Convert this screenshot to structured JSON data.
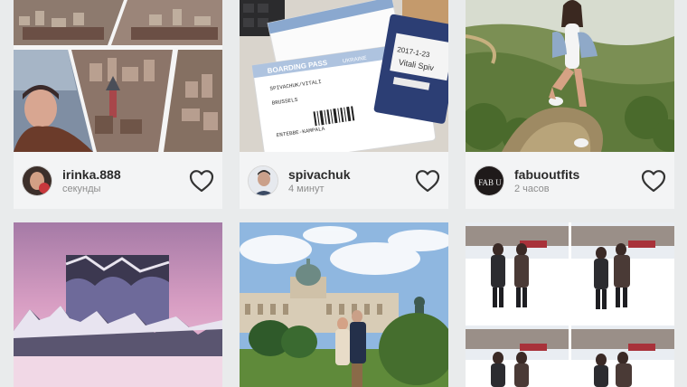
{
  "posts": [
    {
      "username": "irinka.888",
      "time": "секунды",
      "avatar": "avatar-irinka",
      "like_icon": "heart-outline-icon"
    },
    {
      "username": "spivachuk",
      "time": "4 минут",
      "avatar": "avatar-spivachuk",
      "like_icon": "heart-outline-icon"
    },
    {
      "username": "fabuoutfits",
      "time": "2 часов",
      "avatar": "avatar-fabuoutfits",
      "avatar_text": "FAB U",
      "like_icon": "heart-outline-icon"
    }
  ],
  "photos": {
    "boarding_pass": {
      "header": "BOARDING PASS",
      "country": "UKRAINE",
      "name": "SPIVACHUK/VITALI",
      "from": "BRUSSELS",
      "to": "ENTEBBE-KAMPALA",
      "date": "2017-1-23",
      "card_name": "Vitali Spiv"
    }
  },
  "colors": {
    "background": "#e9ebec",
    "card_meta": "#f3f4f5",
    "username": "#2b2b2b",
    "time": "#8d8d8d"
  }
}
